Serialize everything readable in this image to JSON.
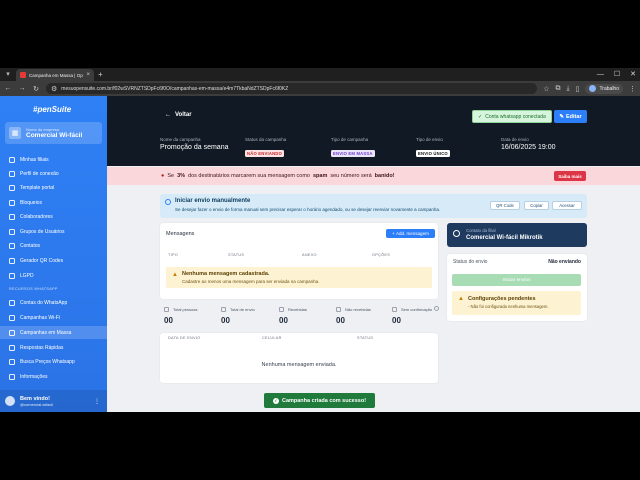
{
  "browser": {
    "tab_title": "Campanha em Massa | OpenS",
    "url": "mesuopensuite.com.br/f02wSVRNZTSDpFc6f0O/campanhas-em-massa/e4m7TkbaNdZTSDpFc6f0KZ",
    "profile": "Trabalho"
  },
  "sidebar": {
    "logo": "#penSuite",
    "company_label": "Nome da empresa",
    "company_name": "Comercial Wi-fácil",
    "items": [
      {
        "label": "Minhas filiais"
      },
      {
        "label": "Perfil de conexão"
      },
      {
        "label": "Template portal"
      },
      {
        "label": "Bloqueios"
      },
      {
        "label": "Colaboradores"
      },
      {
        "label": "Grupos de Usuários"
      },
      {
        "label": "Contatos"
      },
      {
        "label": "Gerador QR Codes"
      },
      {
        "label": "LGPD"
      }
    ],
    "section_label": "RECURSOS WHATSAPP",
    "whatsapp_items": [
      {
        "label": "Contas do WhatsApp"
      },
      {
        "label": "Campanhas Wi-Fi"
      },
      {
        "label": "Campanhas em Massa"
      },
      {
        "label": "Respostas Rápidas"
      },
      {
        "label": "Busca Preços Whatsapp"
      },
      {
        "label": "Informações"
      }
    ],
    "user_name": "Bem vindo!",
    "user_email": "@comercial.wifacil"
  },
  "header": {
    "back_label": "Voltar",
    "connection_badge": "Conta whatsapp conectada",
    "edit_label": "Editar",
    "meta": {
      "name_label": "Nome da campanha",
      "name_value": "Promoção da semana",
      "status_label": "Status da campanha",
      "status_value": "NÃO ENVIANDO",
      "type_label": "Tipo de campanha",
      "type_value": "ENVIO EM MASSA",
      "send_label": "Tipo de envio",
      "send_value": "ENVIO ÚNICO",
      "date_label": "Data de envio",
      "date_value": "16/06/2025 19:00"
    }
  },
  "warning": {
    "prefix": "Se",
    "percent": "3%",
    "middle": "dos destinatários marcarem sua mensagem como",
    "spam": "spam",
    "middle2": "seu número será",
    "banned": "banido!",
    "button": "Saiba mais"
  },
  "manual": {
    "title": "Iniciar envio manualmente",
    "description": "Se desejar fazer o envio de forma manual sem precisar esperar o horário agendado, ou se desejar reenviar novamente a campanha.",
    "qr_label": "QR Code",
    "copy_label": "Copiar",
    "access_label": "Acessar"
  },
  "messages": {
    "title": "Mensagens",
    "add_label": "Add. mensagem",
    "columns": [
      "TIPO",
      "STATUS",
      "ANEXO",
      "OPÇÕES"
    ],
    "empty_title": "Nenhuma mensagem cadastrada.",
    "empty_desc": "Cadastre ao menos uma mensagem para ser enviada na campanha."
  },
  "contact": {
    "label": "Contato da filial",
    "value": "Comercial Wi-fácil Mikrotik"
  },
  "send_status": {
    "label": "Status do envio",
    "value": "Não enviando",
    "start_label": "Iniciar envios",
    "cfg_title": "Configurações pendentes",
    "cfg_item": "- Não foi configurada nenhuma mensagem."
  },
  "stats": [
    {
      "label": "Total pessoas",
      "value": "00"
    },
    {
      "label": "Total de envio",
      "value": "00"
    },
    {
      "label": "Recebidas",
      "value": "00"
    },
    {
      "label": "Não recebidas",
      "value": "00"
    },
    {
      "label": "Sem confirmação",
      "value": "00"
    }
  ],
  "sent_table": {
    "columns": [
      "DATA DE ENVIO",
      "CELULAR",
      "STATUS"
    ],
    "empty": "Nenhuma mensagem enviada."
  },
  "toast": "Campanha criada com sucesso!",
  "colors": {
    "primary": "#2d7ff9",
    "header_bg": "#111a24",
    "danger": "#dc3545",
    "success": "#1f7a3c"
  }
}
